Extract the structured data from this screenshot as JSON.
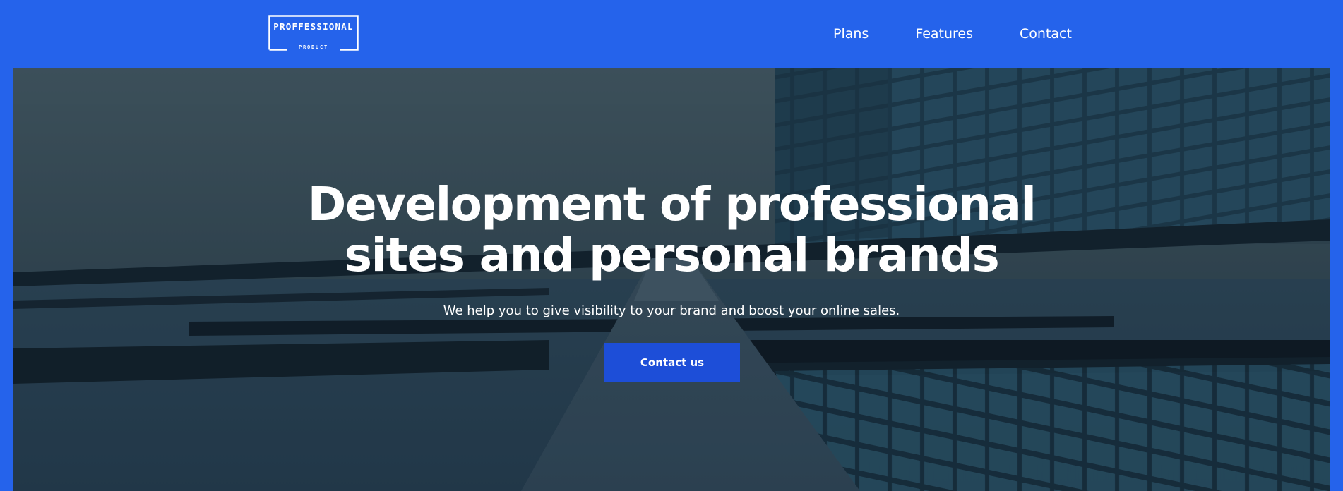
{
  "header": {
    "logo": {
      "main_text": "PROFFESSIONAL",
      "sub_text": "PRODUCT"
    },
    "nav": [
      {
        "label": "Plans"
      },
      {
        "label": "Features"
      },
      {
        "label": "Contact"
      }
    ]
  },
  "hero": {
    "title_line1": "Development of professional",
    "title_line2": "sites and personal brands",
    "subtitle": "We help you to give visibility to your brand and boost your online sales.",
    "cta_label": "Contact us",
    "background_image": "modern-glass-building-with-reflecting-pool"
  },
  "colors": {
    "brand_blue": "#2563eb",
    "button_blue": "#1d4ed8",
    "text_white": "#ffffff",
    "overlay_dark": "#1f3444"
  }
}
